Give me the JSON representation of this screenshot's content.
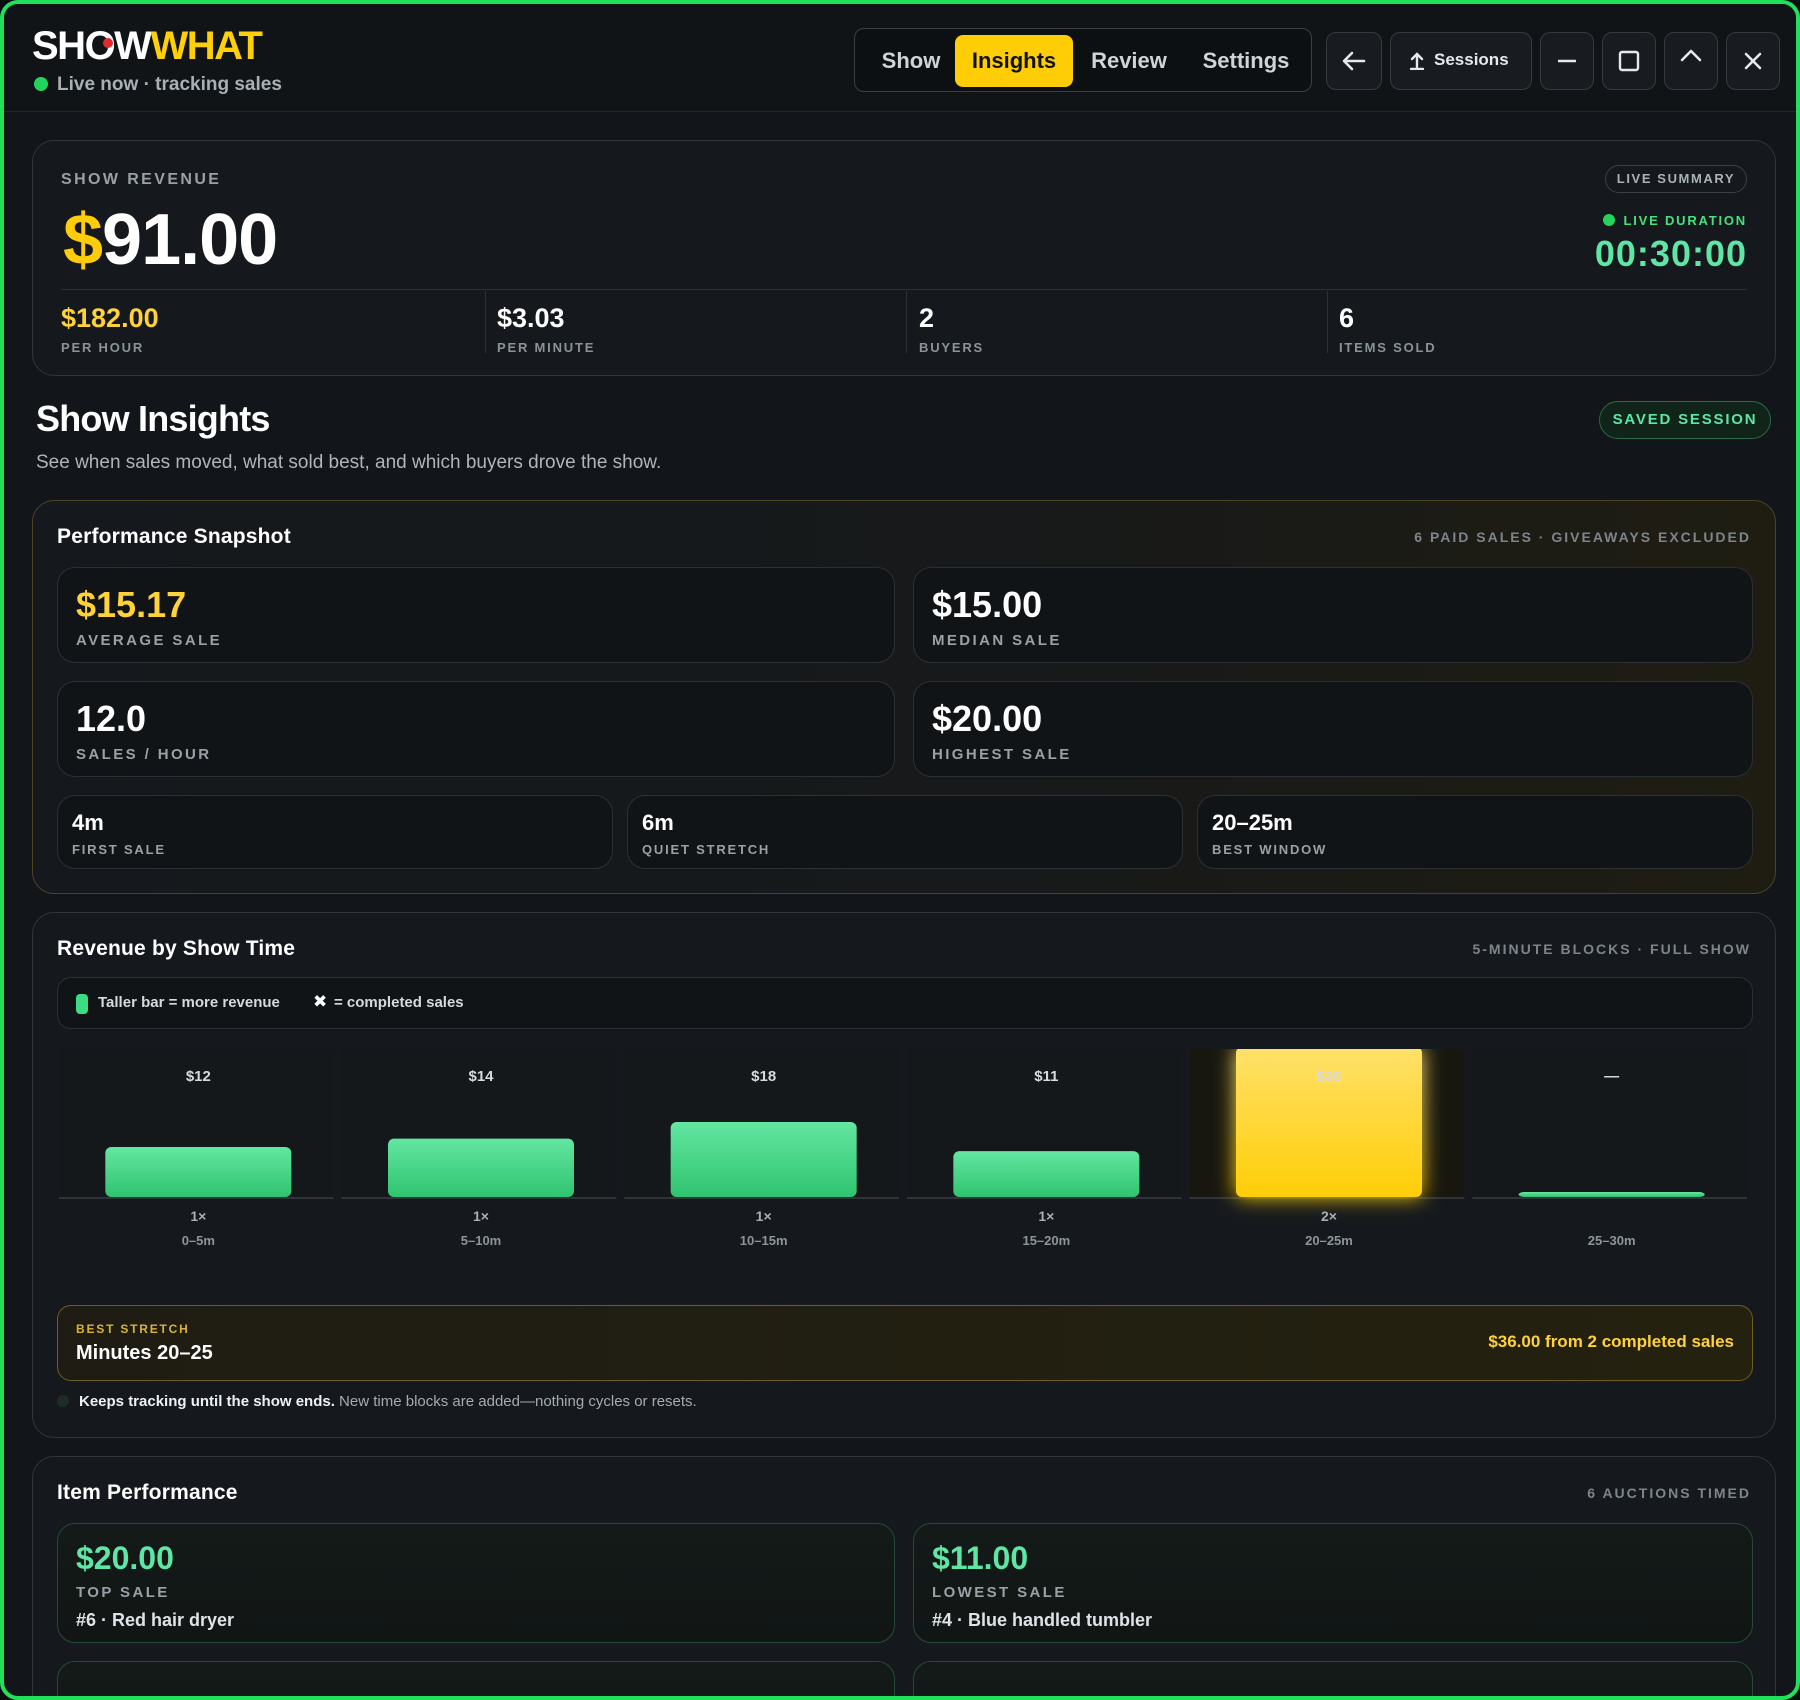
{
  "app": {
    "logo_part1": "SHOW",
    "logo_part2": "WHAT",
    "status": "Live now · tracking sales"
  },
  "tabs": [
    {
      "label": "Show",
      "active": false
    },
    {
      "label": "Insights",
      "active": true
    },
    {
      "label": "Review",
      "active": false
    },
    {
      "label": "Settings",
      "active": false
    }
  ],
  "toolbar": {
    "sessions_label": "Sessions",
    "icons": [
      "back-arrow-icon",
      "upload-icon",
      "minimize-icon",
      "maximize-icon",
      "chevron-up-icon",
      "close-icon"
    ]
  },
  "revenue": {
    "title": "SHOW REVENUE",
    "currency": "$",
    "amount": "91.00",
    "summary_pill": "LIVE SUMMARY",
    "live_duration_label": "LIVE DURATION",
    "live_duration": "00:30:00",
    "stats": [
      {
        "value": "$182.00",
        "label": "PER HOUR"
      },
      {
        "value": "$3.03",
        "label": "PER MINUTE"
      },
      {
        "value": "2",
        "label": "BUYERS"
      },
      {
        "value": "6",
        "label": "ITEMS SOLD"
      }
    ]
  },
  "insights": {
    "title": "Show Insights",
    "subtitle": "See when sales moved, what sold best, and which buyers drove the show.",
    "saved_pill": "SAVED SESSION"
  },
  "snapshot": {
    "title": "Performance Snapshot",
    "meta": "6 PAID SALES · GIVEAWAYS EXCLUDED",
    "tiles": [
      {
        "value": "$15.17",
        "label": "AVERAGE SALE"
      },
      {
        "value": "$15.00",
        "label": "MEDIAN SALE"
      },
      {
        "value": "12.0",
        "label": "SALES / HOUR"
      },
      {
        "value": "$20.00",
        "label": "HIGHEST SALE"
      }
    ],
    "small_tiles": [
      {
        "value": "4m",
        "label": "FIRST SALE"
      },
      {
        "value": "6m",
        "label": "QUIET STRETCH"
      },
      {
        "value": "20–25m",
        "label": "BEST WINDOW"
      }
    ]
  },
  "revenue_chart": {
    "title": "Revenue by Show Time",
    "meta": "5-MINUTE BLOCKS · FULL SHOW",
    "legend_bar": "Taller bar = more revenue",
    "legend_x": "= completed sales",
    "best_label": "BEST STRETCH",
    "best_value": "Minutes 20–25",
    "best_detail": "$36.00 from 2 completed sales",
    "footnote_bold": "Keeps tracking until the show ends.",
    "footnote_rest": " New time blocks are added—nothing cycles or resets."
  },
  "chart_data": {
    "type": "bar",
    "title": "Revenue by Show Time",
    "categories": [
      "0–5m",
      "5–10m",
      "10–15m",
      "15–20m",
      "20–25m",
      "25–30m"
    ],
    "values": [
      12,
      14,
      18,
      11,
      36,
      0
    ],
    "value_labels": [
      "$12",
      "$14",
      "$18",
      "$11",
      "$36",
      "—"
    ],
    "counts": [
      "1×",
      "1×",
      "1×",
      "1×",
      "2×",
      ""
    ],
    "highlight_index": 4,
    "ylim": [
      0,
      36
    ],
    "colors": {
      "bar": "#3ddc84",
      "highlight": "#ffd21a"
    }
  },
  "items": {
    "title": "Item Performance",
    "meta": "6 AUCTIONS TIMED",
    "tiles": [
      {
        "value": "$20.00",
        "label": "TOP SALE",
        "name": "#6 · Red hair dryer"
      },
      {
        "value": "$11.00",
        "label": "LOWEST SALE",
        "name": "#4 · Blue handled tumbler"
      }
    ]
  }
}
